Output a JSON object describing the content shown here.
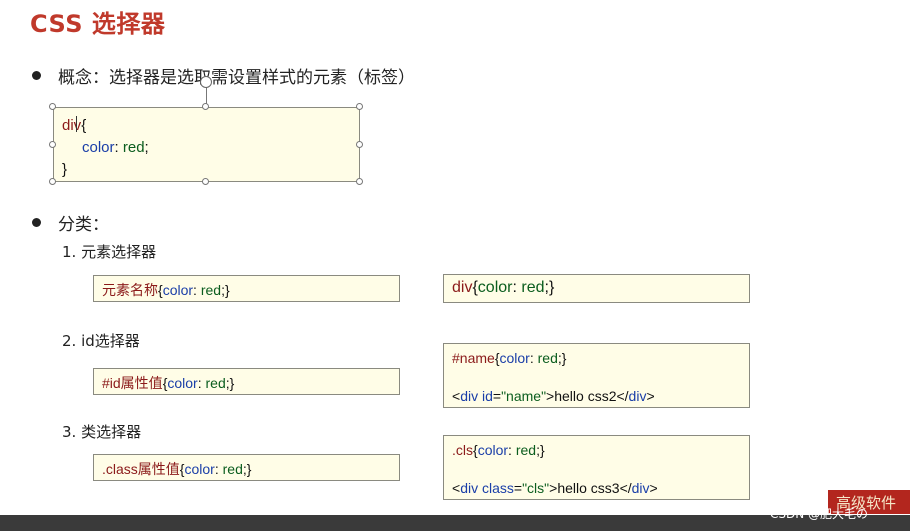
{
  "slide": {
    "title": "CSS 选择器",
    "bullet1": "概念：选择器是选取需设置样式的元素（标签）",
    "main_code": {
      "line1_kw": "div",
      "line1_brace": "{",
      "line2_prop": "color",
      "line2_sep": ": ",
      "line2_val": "red",
      "line2_end": ";",
      "line3": "}"
    },
    "bullet2": "分类：",
    "items": [
      {
        "label": "1.   元素选择器",
        "left_kw": "元素名称",
        "left_rest_open": "{",
        "left_prop": "color",
        "left_sep": ": ",
        "left_val": "red",
        "left_close": ";}",
        "right_kw": "div",
        "right_open": "{",
        "right_prop": "color",
        "right_sep": ": ",
        "right_val": "red",
        "right_close": ";}"
      },
      {
        "label": "2.   id选择器",
        "left_kw": "#id属性值",
        "left_rest_open": "{",
        "left_prop": "color",
        "left_sep": ": ",
        "left_val": "red",
        "left_close": ";}",
        "right_l1_kw": "#name",
        "right_l1_open": "{",
        "right_l1_prop": "color",
        "right_l1_sep": ": ",
        "right_l1_val": "red",
        "right_l1_close": ";}",
        "right_l2_open": "<",
        "right_l2_tag": "div",
        "right_l2_attr": " id",
        "right_l2_eq": "=",
        "right_l2_str": "\"name\"",
        "right_l2_text": ">hello css2</",
        "right_l2_tag2": "div",
        "right_l2_end": ">"
      },
      {
        "label": "3.   类选择器",
        "left_kw": ".class属性值",
        "left_rest_open": "{",
        "left_prop": "color",
        "left_sep": ": ",
        "left_val": "red",
        "left_close": ";}",
        "right_l1_kw": ".cls",
        "right_l1_open": "{",
        "right_l1_prop": "color",
        "right_l1_sep": ": ",
        "right_l1_val": "red",
        "right_l1_close": ";}",
        "right_l2_open": "<",
        "right_l2_tag": "div",
        "right_l2_attr": " class",
        "right_l2_eq": "=",
        "right_l2_str": "\"cls\"",
        "right_l2_text": ">hello css3</",
        "right_l2_tag2": "div",
        "right_l2_end": ">"
      }
    ]
  },
  "footer": {
    "watermark": "CSDN @肥大毛の",
    "logo_text": "高级软件"
  },
  "colors": {
    "title": "#c0392b",
    "selector": "#8b1a1a",
    "property": "#1a3ea8",
    "value": "#0b5d1e",
    "code_bg": "#fffde7"
  }
}
